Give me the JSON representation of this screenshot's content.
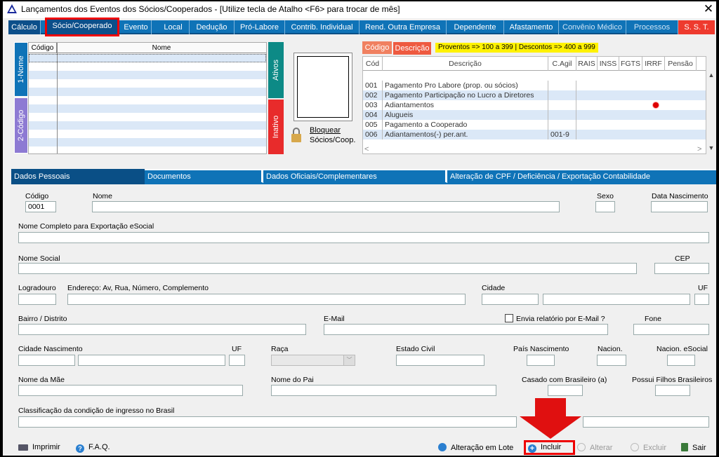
{
  "window": {
    "title": "Lançamentos dos Eventos dos Sócios/Cooperados - [Utilize tecla de Atalho <F6> para trocar de mês]",
    "close": "✕"
  },
  "nav": [
    "Cálculo",
    "Sócio/Cooperado",
    "Evento",
    "Local",
    "Dedução",
    "Pró-Labore",
    "Contrib. Individual",
    "Rend. Outra Empresa",
    "Dependente",
    "Afastamento",
    "Convênio Médico",
    "Processos",
    "S. S. T."
  ],
  "members": {
    "col_codigo": "Código",
    "col_nome": "Nome",
    "tab_nome": "1-Nome",
    "tab_codigo": "2-Código",
    "ativos": "Ativos",
    "inativo": "Inativo",
    "bloquear_1": "Bloquear",
    "bloquear_2": "Sócios/Coop."
  },
  "events": {
    "btn_codigo": "Código",
    "btn_descricao": "Descrição",
    "legend": "Proventos => 100 a 399 | Descontos => 400 a 999",
    "headers": [
      "Cód",
      "Descrição",
      "C.Agil",
      "RAIS",
      "INSS",
      "FGTS",
      "IRRF",
      "Pensão",
      ""
    ],
    "rows": [
      {
        "cod": "001",
        "desc": "Pagamento Pro Labore (prop. ou sócios)",
        "cagil": ""
      },
      {
        "cod": "002",
        "desc": "Pagamento Participação no Lucro a Diretores",
        "cagil": ""
      },
      {
        "cod": "003",
        "desc": "Adiantamentos",
        "cagil": ""
      },
      {
        "cod": "004",
        "desc": "Alugueis",
        "cagil": ""
      },
      {
        "cod": "005",
        "desc": "Pagamento a Cooperado",
        "cagil": ""
      },
      {
        "cod": "006",
        "desc": "Adiantamentos(-) per.ant.",
        "cagil": "001-9"
      }
    ]
  },
  "subtabs": [
    "Dados Pessoais",
    "Documentos",
    "Dados Oficiais/Complementares",
    "Alteração de CPF / Deficiência / Exportação Contabilidade"
  ],
  "form": {
    "codigo_label": "Código",
    "codigo_value": "0001",
    "nome_label": "Nome",
    "sexo_label": "Sexo",
    "data_nasc_label": "Data Nascimento",
    "nome_esocial_label": "Nome Completo para Exportação eSocial",
    "nome_social_label": "Nome Social",
    "cep_label": "CEP",
    "logradouro_label": "Logradouro",
    "endereco_label": "Endereço: Av, Rua, Número, Complemento",
    "cidade_label": "Cidade",
    "uf_label": "UF",
    "bairro_label": "Bairro / Distrito",
    "email_label": "E-Mail",
    "envia_label": "Envia relatório por E-Mail ?",
    "fone_label": "Fone",
    "cidade_nasc_label": "Cidade Nascimento",
    "uf2_label": "UF",
    "raca_label": "Raça",
    "estado_civil_label": "Estado Civil",
    "pais_nasc_label": "País Nascimento",
    "nacion_label": "Nacion.",
    "nacion_esocial_label": "Nacion. eSocial",
    "mae_label": "Nome da Mãe",
    "pai_label": "Nome do Pai",
    "casado_label": "Casado com Brasileiro (a)",
    "filhos_label": "Possui Filhos Brasileiros",
    "classificacao_label": "Classificação da condição de ingresso no Brasil"
  },
  "bottom": {
    "imprimir": "Imprimir",
    "faq": "F.A.Q.",
    "lote": "Alteração em Lote",
    "incluir": "Incluir",
    "alterar": "Alterar",
    "excluir": "Excluir",
    "sair": "Sair"
  }
}
